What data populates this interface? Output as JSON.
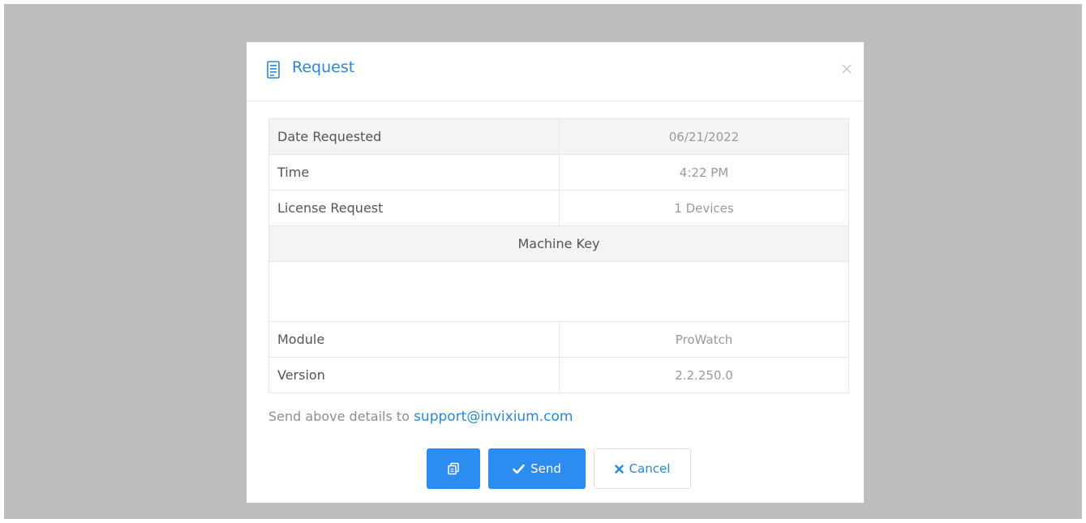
{
  "dialog": {
    "title": "Request",
    "header_icon": "document-icon",
    "close_icon": "close-icon"
  },
  "details": {
    "rows": [
      {
        "label": "Date Requested",
        "value": "06/21/2022"
      },
      {
        "label": "Time",
        "value": "4:22 PM"
      },
      {
        "label": "License Request",
        "value": "1 Devices"
      }
    ],
    "machine_key_label": "Machine Key",
    "machine_key_value": "",
    "rows_after": [
      {
        "label": "Module",
        "value": "ProWatch"
      },
      {
        "label": "Version",
        "value": "2.2.250.0"
      }
    ]
  },
  "note": {
    "text": "Send above details to ",
    "email": "support@invixium.com"
  },
  "buttons": {
    "copy_icon": "copy-icon",
    "send_label": "Send",
    "send_icon": "check-icon",
    "cancel_label": "Cancel",
    "cancel_icon": "x-icon"
  },
  "colors": {
    "accent": "#2d8cf0",
    "link": "#2a87d8",
    "backdrop": "#bdbdbd"
  }
}
